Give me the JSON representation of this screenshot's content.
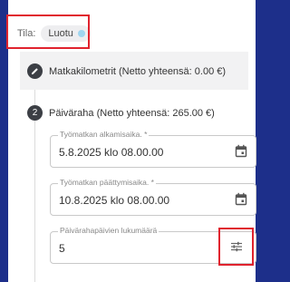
{
  "status": {
    "label": "Tila:",
    "value": "Luotu",
    "dot_color": "#9fd6f0"
  },
  "sections": [
    {
      "icon": "pencil-icon",
      "title": "Matkakilometrit (Netto yhteensä: 0.00 €)"
    },
    {
      "number": "2",
      "title": "Päiväraha (Netto yhteensä: 265.00 €)"
    }
  ],
  "fields": {
    "start": {
      "label": "Työmatkan alkamisaika. *",
      "value": "5.8.2025 klo 08.00.00",
      "icon": "calendar-icon"
    },
    "end": {
      "label": "Työmatkan päättymisaika. *",
      "value": "10.8.2025 klo 08.00.00",
      "icon": "calendar-icon"
    },
    "days": {
      "label": "Päivärahapäivien lukumäärä",
      "value": "5",
      "icon": "tune-icon"
    }
  },
  "colors": {
    "frame": "#1d2f8a",
    "highlight": "#e0232e",
    "step": "#3c3f45"
  }
}
